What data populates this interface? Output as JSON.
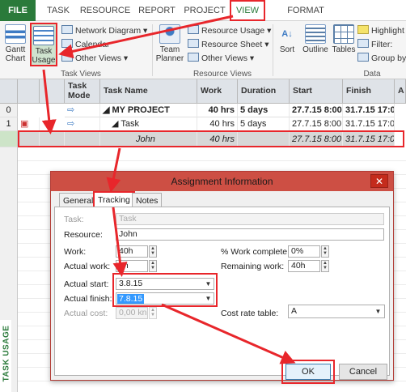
{
  "ribbon": {
    "tabs": [
      "FILE",
      "TASK",
      "RESOURCE",
      "REPORT",
      "PROJECT",
      "VIEW",
      "FORMAT"
    ],
    "gantt_chart": "Gantt\nChart",
    "task_usage": "Task\nUsage",
    "network_diagram": "Network Diagram",
    "calendar": "Calendar",
    "other_views_task": "Other Views",
    "team_planner": "Team\nPlanner",
    "resource_usage": "Resource Usage",
    "resource_sheet": "Resource Sheet",
    "other_views_resource": "Other Views",
    "sort": "Sort",
    "outline": "Outline",
    "tables": "Tables",
    "highlight": "Highlight",
    "filter": "Filter:",
    "group_by": "Group by:",
    "group_task_views": "Task Views",
    "group_resource_views": "Resource Views",
    "group_data": "Data"
  },
  "grid": {
    "headers": [
      "Task Mode",
      "Task Name",
      "Work",
      "Duration",
      "Start",
      "Finish",
      "A"
    ],
    "rows": [
      {
        "num": "0",
        "name": "MY PROJECT",
        "work": "40 hrs",
        "duration": "5 days",
        "start": "27.7.15 8:00",
        "finish": "31.7.15 17:00"
      },
      {
        "num": "1",
        "name": "Task",
        "work": "40 hrs",
        "duration": "5 days",
        "start": "27.7.15 8:00",
        "finish": "31.7.15 17:00"
      },
      {
        "num": "",
        "name": "John",
        "work": "40 hrs",
        "duration": "",
        "start": "27.7.15 8:00",
        "finish": "31.7.15 17:00"
      }
    ],
    "side_label": "TASK USAGE"
  },
  "dialog": {
    "title": "Assignment Information",
    "close": "✕",
    "tabs": [
      "General",
      "Tracking",
      "Notes"
    ],
    "task_label": "Task:",
    "task_value": "Task",
    "resource_label": "Resource:",
    "resource_value": "John",
    "work_label": "Work:",
    "work_value": "40h",
    "actual_work_label": "Actual work:",
    "actual_work_value": "0h",
    "actual_start_label": "Actual start:",
    "actual_start_value": "3.8.15",
    "actual_finish_label": "Actual finish:",
    "actual_finish_value": "7.8.15",
    "actual_cost_label": "Actual cost:",
    "actual_cost_value": "0,00 kn",
    "pct_work_label": "% Work complete:",
    "pct_work_value": "0%",
    "remaining_work_label": "Remaining work:",
    "remaining_work_value": "40h",
    "cost_rate_label": "Cost rate table:",
    "cost_rate_value": "A",
    "ok": "OK",
    "cancel": "Cancel"
  },
  "colors": {
    "accent": "#2a7a3a",
    "annotation": "#e8262b",
    "dialog_title": "#cd4f44"
  }
}
